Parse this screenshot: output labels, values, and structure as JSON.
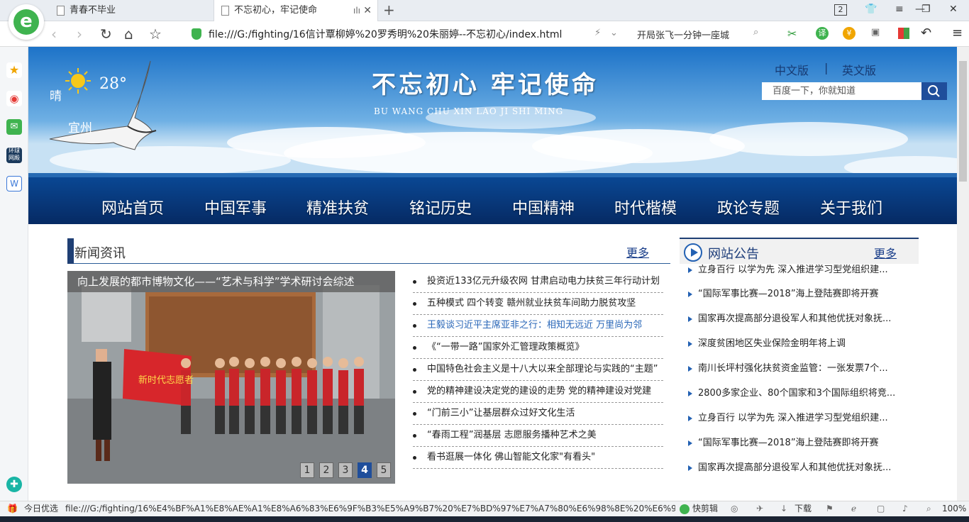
{
  "browser": {
    "tabs": [
      {
        "label": "青春不毕业",
        "active": false
      },
      {
        "label": "不忘初心，牢记使命",
        "active": true
      }
    ],
    "tab_count": "2",
    "url": "file:///G:/fighting/16信计覃柳婷%20罗秀明%20朱丽婷--不忘初心/index.html",
    "search_text": "开局张飞一分钟一座城",
    "status_left": "今日优选",
    "status_url": "file:///G:/fighting/16%E4%BF%A1%E8%AE%A1%E8%A6%83%E6%9F%B3%E5%A9%B7%20%E7%BD%97%E7%A7%80%E6%98%8E%20%E6%9C%B1%",
    "status_quick": "快剪辑",
    "status_download": "下载",
    "zoom": "100%"
  },
  "header": {
    "weather": "晴",
    "temp": "28°",
    "city": "宜州",
    "title": "不忘初心 牢记使命",
    "title_pinyin": "BU  WANG  CHU  XIN       LAO  JI  SHI MING",
    "lang_zh": "中文版",
    "lang_sep": "|",
    "lang_en": "英文版",
    "search_placeholder": "百度一下，你就知道"
  },
  "nav": {
    "items": [
      "网站首页",
      "中国军事",
      "精准扶贫",
      "铭记历史",
      "中国精神",
      "时代楷模",
      "政论专题",
      "关于我们"
    ]
  },
  "news": {
    "title": "新闻资讯",
    "more": "更多",
    "photo_caption": "向上发展的都市博物文化——“艺术与科学”学术研讨会综述",
    "banner_text": "新时代志愿者",
    "pages": [
      "1",
      "2",
      "3",
      "4",
      "5"
    ],
    "active_page": "4",
    "items": [
      "投资近133亿元升级农网 甘肃启动电力扶贫三年行动计划",
      "五种模式  四个转变  赣州就业扶贫车间助力脱贫攻坚",
      "王毅谈习近平主席亚非之行：相知无远近 万里尚为邻",
      "《“一带一路”国家外汇管理政策概览》",
      "中国特色社会主义是十八大以来全部理论与实践的“主题”",
      "党的精神建设决定党的建设的走势 党的精神建设对党建",
      "“门前三小”让基层群众过好文化生活",
      "“春雨工程”润基层 志愿服务播种艺术之美",
      "看书逛展一体化 佛山智能文化家\"有看头\""
    ]
  },
  "notice": {
    "title": "网站公告",
    "more": "更多",
    "items": [
      "立身百行 以学为先 深入推进学习型党组织建...",
      "“国际军事比赛—2018”海上登陆赛即将开赛",
      "国家再次提高部分退役军人和其他优抚对象抚...",
      "深度贫困地区失业保险金明年将上调",
      "南川长坪村强化扶贫资金监管：一张发票7个...",
      "2800多家企业、80个国家和3个国际组织将竞...",
      "立身百行 以学为先 深入推进学习型党组织建...",
      "“国际军事比赛—2018”海上登陆赛即将开赛",
      "国家再次提高部分退役军人和其他优抚对象抚..."
    ]
  },
  "colors": {
    "accent": "#1f4e9b",
    "browser_green": "#3fb34f",
    "nav_text": "#ffffff"
  }
}
